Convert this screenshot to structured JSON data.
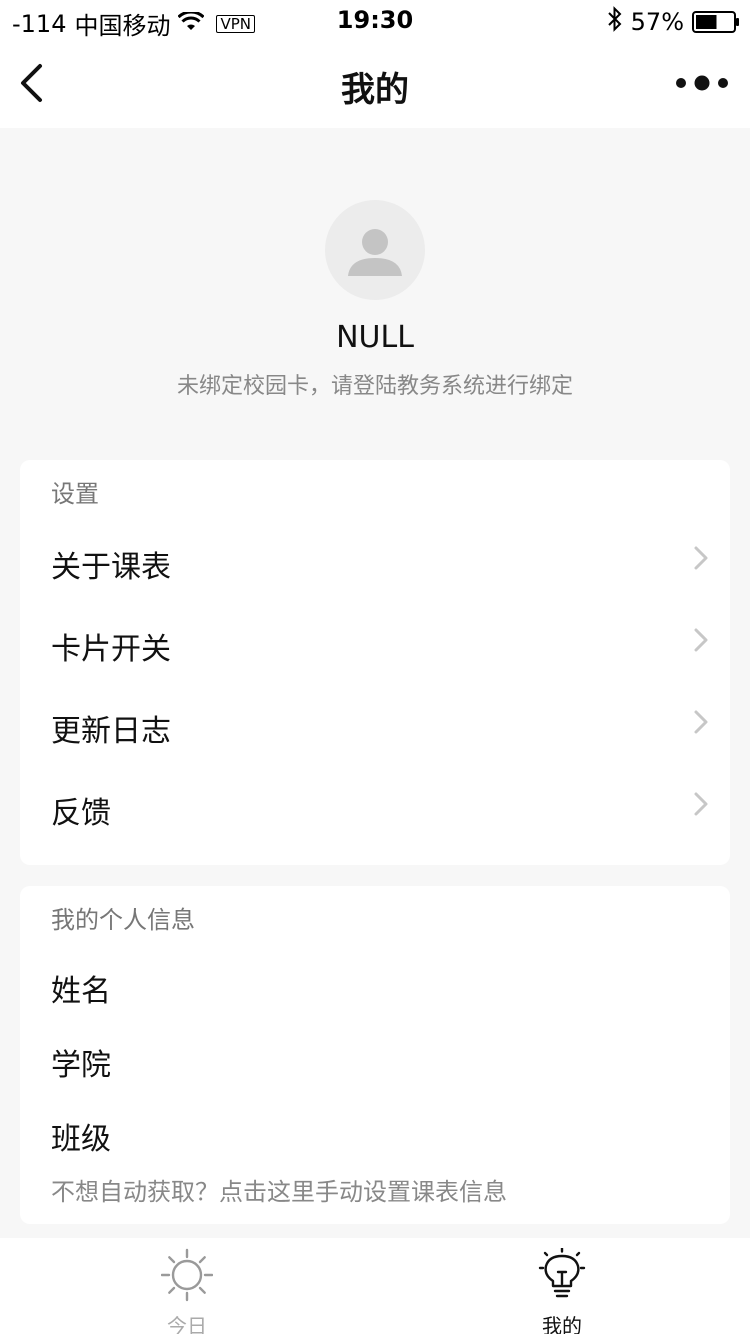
{
  "status_bar": {
    "signal": "-114",
    "carrier": "中国移动",
    "vpn": "VPN",
    "time": "19:30",
    "battery_percent": "57%",
    "battery_level": 0.57
  },
  "nav": {
    "title": "我的",
    "back_icon": "chevron-left-icon",
    "more_icon": "more-dots-icon"
  },
  "profile": {
    "name": "NULL",
    "hint": "未绑定校园卡，请登陆教务系统进行绑定",
    "avatar_icon": "user-avatar-icon"
  },
  "settings": {
    "title": "设置",
    "items": [
      {
        "label": "关于课表"
      },
      {
        "label": "卡片开关"
      },
      {
        "label": "更新日志"
      },
      {
        "label": "反馈"
      }
    ]
  },
  "info": {
    "title": "我的个人信息",
    "fields": [
      {
        "label": "姓名"
      },
      {
        "label": "学院"
      },
      {
        "label": "班级"
      }
    ],
    "manual_link": "不想自动获取？点击这里手动设置课表信息"
  },
  "tabs": [
    {
      "label": "今日",
      "icon": "sun-icon",
      "active": false
    },
    {
      "label": "我的",
      "icon": "lightbulb-icon",
      "active": true
    }
  ],
  "colors": {
    "background": "#f7f7f7",
    "card": "#ffffff",
    "muted_text": "#888888",
    "inactive_tab": "#aaaaaa"
  }
}
